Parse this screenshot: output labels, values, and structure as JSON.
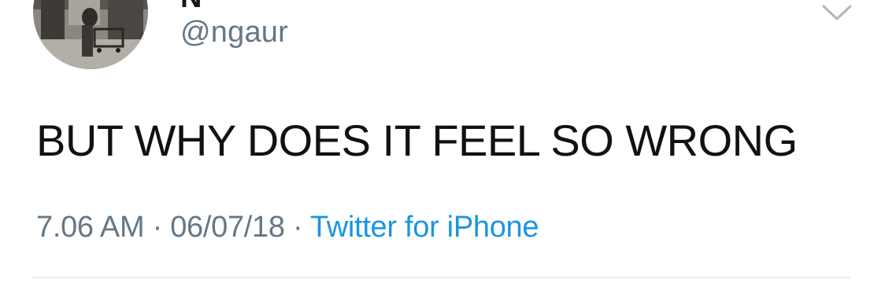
{
  "tweet": {
    "display_name": "N",
    "handle": "@ngaur",
    "text": "BUT WHY DOES IT FEEL SO WRONG",
    "time": "7.06 AM",
    "separator": " · ",
    "date": "06/07/18",
    "source": "Twitter for iPhone"
  },
  "icons": {
    "menu": "chevron-down-icon",
    "avatar": "profile-photo"
  },
  "colors": {
    "text": "#111111",
    "secondary": "#657786",
    "link": "#1b95e0",
    "divider": "#e6ecf0"
  }
}
